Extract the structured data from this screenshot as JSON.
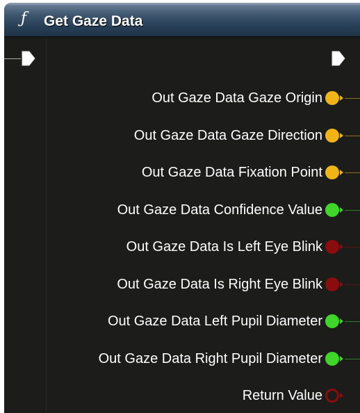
{
  "node": {
    "title": "Get Gaze Data",
    "function_icon": "ƒ",
    "header_color": "#3f5870"
  },
  "exec": {
    "in_icon": "exec-in-pin-icon",
    "out_icon": "exec-out-pin-icon"
  },
  "outputs": [
    {
      "label": "Out Gaze Data Gaze Origin",
      "color": "#f0b417",
      "icon": "vector-pin-icon"
    },
    {
      "label": "Out Gaze Data Gaze Direction",
      "color": "#f0b417",
      "icon": "vector-pin-icon"
    },
    {
      "label": "Out Gaze Data Fixation Point",
      "color": "#f0b417",
      "icon": "vector-pin-icon"
    },
    {
      "label": "Out Gaze Data Confidence Value",
      "color": "#3fd62a",
      "icon": "float-pin-icon"
    },
    {
      "label": "Out Gaze Data Is Left Eye Blink",
      "color": "#8a0c0c",
      "icon": "bool-pin-icon"
    },
    {
      "label": "Out Gaze Data Is Right Eye Blink",
      "color": "#8a0c0c",
      "icon": "bool-pin-icon"
    },
    {
      "label": "Out Gaze Data Left Pupil Diameter",
      "color": "#3fd62a",
      "icon": "float-pin-icon"
    },
    {
      "label": "Out Gaze Data Right Pupil Diameter",
      "color": "#3fd62a",
      "icon": "float-pin-icon"
    },
    {
      "label": "Return Value",
      "color": "#8a0c0c",
      "icon": "bool-pin-unconnected-icon",
      "hollow": true
    }
  ]
}
